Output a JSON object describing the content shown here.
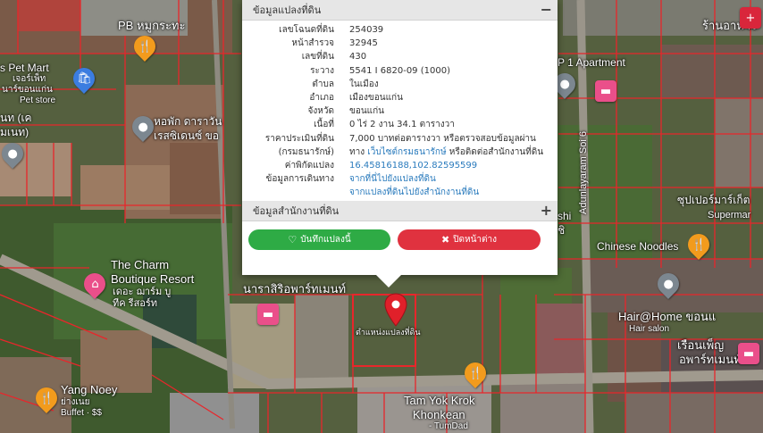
{
  "popup": {
    "section1_title": "ข้อมูลแปลงที่ดิน",
    "section1_toggle": "−",
    "section2_title": "ข้อมูลสำนักงานที่ดิน",
    "section2_toggle": "+",
    "fields": [
      {
        "label": "เลขโฉนดที่ดิน",
        "value": "254039"
      },
      {
        "label": "หน้าสำรวจ",
        "value": "32945"
      },
      {
        "label": "เลขที่ดิน",
        "value": "430"
      },
      {
        "label": "ระวาง",
        "value": "5541 I 6820-09 (1000)"
      },
      {
        "label": "ตำบล",
        "value": "ในเมือง"
      },
      {
        "label": "อำเภอ",
        "value": "เมืองขอนแก่น"
      },
      {
        "label": "จังหวัด",
        "value": "ขอนแก่น"
      },
      {
        "label": "เนื้อที่",
        "value": "0 ไร่ 2 งาน 34.1 ตารางวา"
      }
    ],
    "price_label_1": "ราคาประเมินที่ดิน",
    "price_label_2": "(กรมธนารักษ์)",
    "price_line_1": "7,000 บาทต่อตารางวา หรือตรวจสอบข้อมูลผ่าน",
    "price_line_2_pre": "ทาง ",
    "price_line_2_link": "เว็บไซต์กรมธนารักษ์",
    "price_line_2_post": " หรือติดต่อสำนักงานที่ดิน",
    "coord_label": "ค่าพิกัดแปลง",
    "coord_value": "16.45816188,102.82595599",
    "travel_label": "ข้อมูลการเดินทาง",
    "travel_link_1": "จากที่นี่ไปยังแปลงที่ดิน",
    "travel_link_2": "จากแปลงที่ดินไปยังสำนักงานที่ดิน",
    "save_label": "บันทึกแปลงนี้",
    "close_label": "ปิดหน้าต่าง"
  },
  "map": {
    "labels": {
      "pb": "PB หมูกระทะ",
      "pet_mart": "s Pet Mart",
      "pet_mart_th": "เจอร์เพ็ท",
      "pet_mart_th2": "นาร์ขอนแก่น",
      "pet_store": "Pet store",
      "top_left": "นท (เค",
      "top_left2": "มเนท)",
      "dorm": "หอพัก ดาราวัน",
      "dorm2": "เรสซิเดนซ์ ขอ",
      "charm": "The Charm",
      "charm2": "Boutique Resort",
      "charm_th": "เดอะ ฌาร์ม บู",
      "charm_th2": "ทีค รีสอร์ท",
      "yang": "Yang Noey",
      "yang_th": "ย่างเนย",
      "buffet": "Buffet · $$",
      "narasiri": "นาราสิริอพาร์ทเมนท์",
      "plot_pos": "ตำแหน่งแปลงที่ดิน",
      "tam_yok": "Tam Yok Krok",
      "khonkean": "Khonkean",
      "tumdad": "- TumDad",
      "adun": "Adunlayaram Soi 6",
      "apartment": "P 1 Apartment",
      "kitchen": "ร้านอาหาร",
      "supermart": "ซุปเปอร์มาร์เก็ต",
      "supermart_en": "Supermar",
      "chinese": "Chinese Noodles",
      "hair": "Hair@Home ขอนแ",
      "hair_salon": "Hair salon",
      "ruenpet": "เรือนเพ็ญ",
      "ruenpet2": "อพาร์ทเมนท์",
      "shi": "shi",
      "shi2": "ชิ"
    },
    "colors": {
      "parcel_line": "#e8262b",
      "save_green": "#2eab45",
      "close_red": "#e0323f",
      "link_blue": "#2a7bbd"
    },
    "icons": [
      "fork-knife-icon",
      "shopping-bag-icon",
      "pin-icon",
      "bed-icon",
      "hospital-icon",
      "location-marker-icon"
    ]
  }
}
